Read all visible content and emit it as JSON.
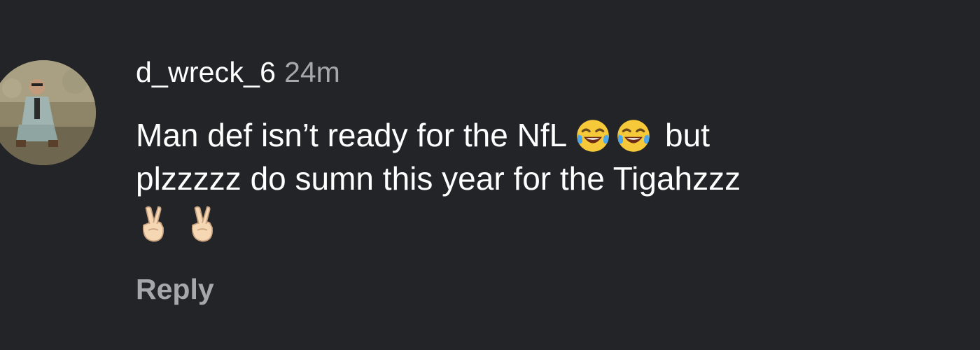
{
  "comment": {
    "username": "d_wreck_6",
    "timestamp": "24m",
    "text_line1_before_emoji": "Man def isn’t ready for the NfL ",
    "text_line1_after_emoji": " but",
    "text_line2": "plzzzzz do sumn this year for the Tigahzzz",
    "emojis_line1": [
      "face-with-tears-of-joy-icon",
      "face-with-tears-of-joy-icon"
    ],
    "emojis_line3": [
      "crossed-fingers-icon",
      "crossed-fingers-icon"
    ],
    "reply_label": "Reply"
  },
  "colors": {
    "background": "#232428",
    "text_primary": "#ffffff",
    "text_secondary": "#a6a7ab"
  }
}
